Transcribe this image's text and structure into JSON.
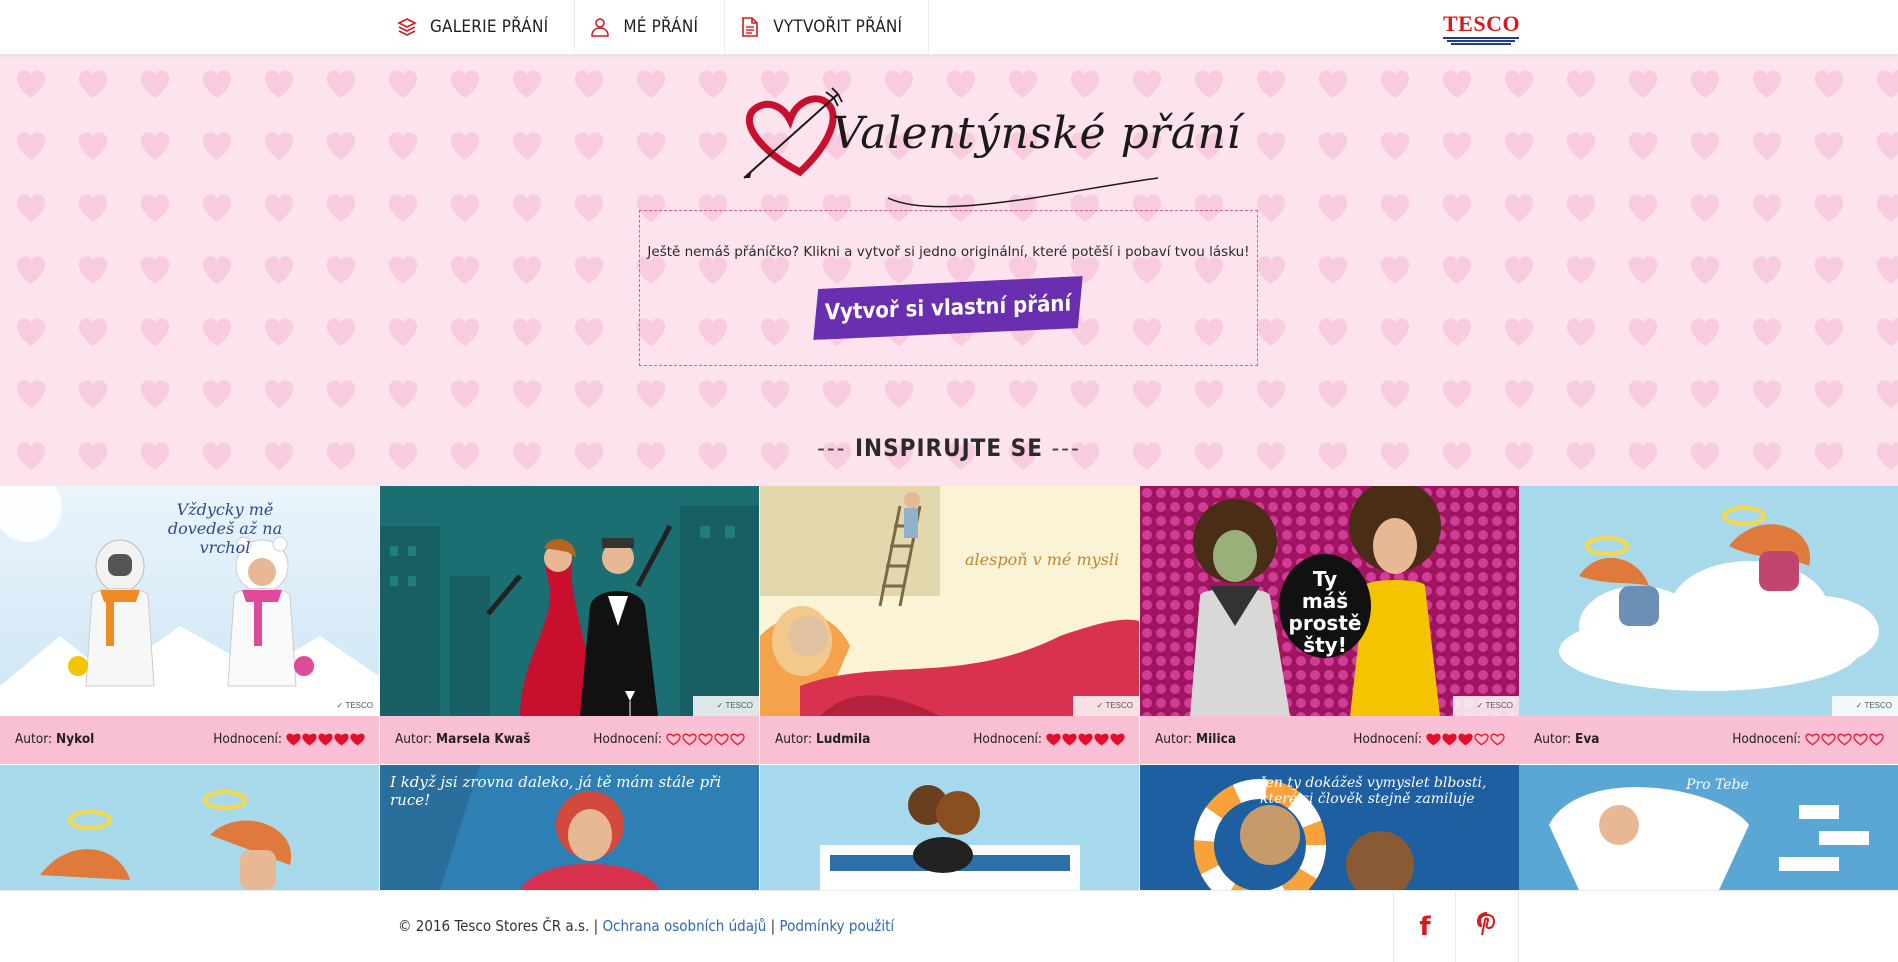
{
  "nav": {
    "items": [
      {
        "label": "GALERIE PŘÁNÍ",
        "icon": "stack-icon"
      },
      {
        "label": "MÉ PŘÁNÍ",
        "icon": "user-icon"
      },
      {
        "label": "VYTVOŘIT PŘÁNÍ",
        "icon": "document-icon"
      }
    ],
    "brand": "TESCO"
  },
  "hero": {
    "logo_text": "Valentýnské přání",
    "promo_text": "Ještě nemáš přáníčko? Klikni a vytvoř si jedno originální, které potěší i pobaví tvou lásku!",
    "cta_label": "Vytvoř si vlastní přání",
    "section_title": "INSPIRUJTE SE",
    "section_dashes": "---"
  },
  "gallery": {
    "author_label": "Autor:",
    "rating_label": "Hodnocení:",
    "cards": [
      {
        "author": "Nykol",
        "rating": 5,
        "caption": "Vždycky mě dovedeš až na vrchol"
      },
      {
        "author": "Marsela Kwaš",
        "rating": 0,
        "caption": ""
      },
      {
        "author": "Ludmila",
        "rating": 5,
        "caption": "alespoň v mé mysli"
      },
      {
        "author": "Milica",
        "rating": 3,
        "caption": "Ty máš prostě šty!"
      },
      {
        "author": "Eva",
        "rating": 0,
        "caption": ""
      }
    ],
    "row2_captions": [
      "",
      "I když jsi zrovna daleko, já tě mám stále při ruce!",
      "",
      "Jen ty dokážeš vymyslet blbosti, které si člověk stejně zamiluje",
      "Pro Tebe"
    ]
  },
  "footer": {
    "copyright": "© 2016 Tesco Stores ČR a.s. |",
    "privacy_link": "Ochrana osobních údajů",
    "separator": "|",
    "terms_link": "Podmínky použití"
  },
  "colors": {
    "accent": "#6a2fb0",
    "brand_red": "#d71920",
    "hero_bg": "#fce0ec",
    "meta_bg": "#f9bfd2",
    "heart_red": "#e0102c"
  }
}
